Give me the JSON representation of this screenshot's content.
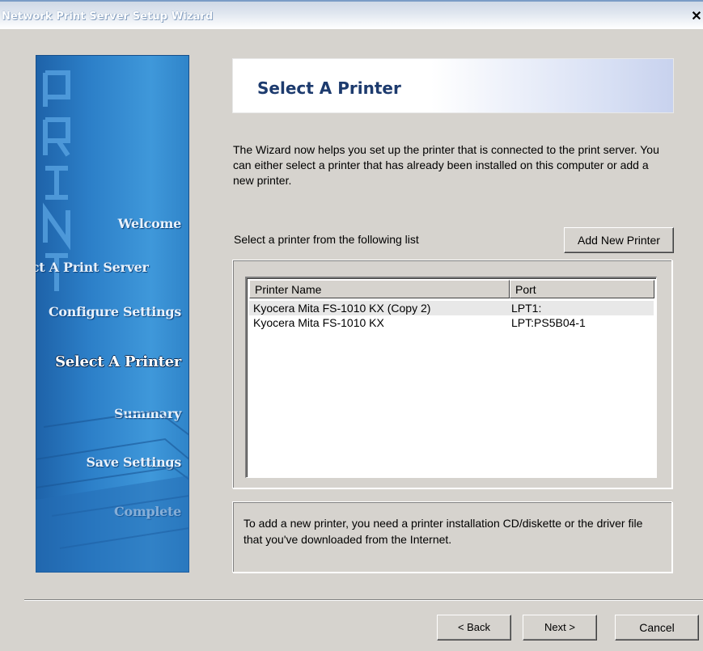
{
  "window": {
    "title": "Network Print Server Setup Wizard",
    "close_glyph": "✕"
  },
  "sidebar": {
    "watermark_text": "PRINT",
    "steps": [
      {
        "label": "Welcome"
      },
      {
        "label": "Select A Print Server"
      },
      {
        "label": "Configure Settings"
      },
      {
        "label": "Select A Printer"
      },
      {
        "label": "Summary"
      },
      {
        "label": "Save Settings"
      },
      {
        "label": "Complete"
      }
    ]
  },
  "header": {
    "title": "Select A Printer"
  },
  "description": "The Wizard now helps you set up the printer that is connected to the print server. You can either select a printer that has already been installed on this computer or add a new printer.",
  "printer_list": {
    "label": "Select a printer from the following list",
    "add_button": "Add New Printer",
    "columns": [
      "Printer Name",
      "Port"
    ],
    "rows": [
      {
        "name": "Kyocera Mita FS-1010 KX (Copy 2)",
        "port": "LPT1:",
        "selected": true
      },
      {
        "name": "Kyocera Mita FS-1010 KX",
        "port": "LPT:PS5B04-1",
        "selected": false
      }
    ]
  },
  "note": "To add a new printer, you need a printer installation CD/diskette or the driver file that you've downloaded from the Internet.",
  "footer": {
    "back_label": "< Back",
    "next_label": "Next >",
    "cancel_label": "Cancel"
  }
}
